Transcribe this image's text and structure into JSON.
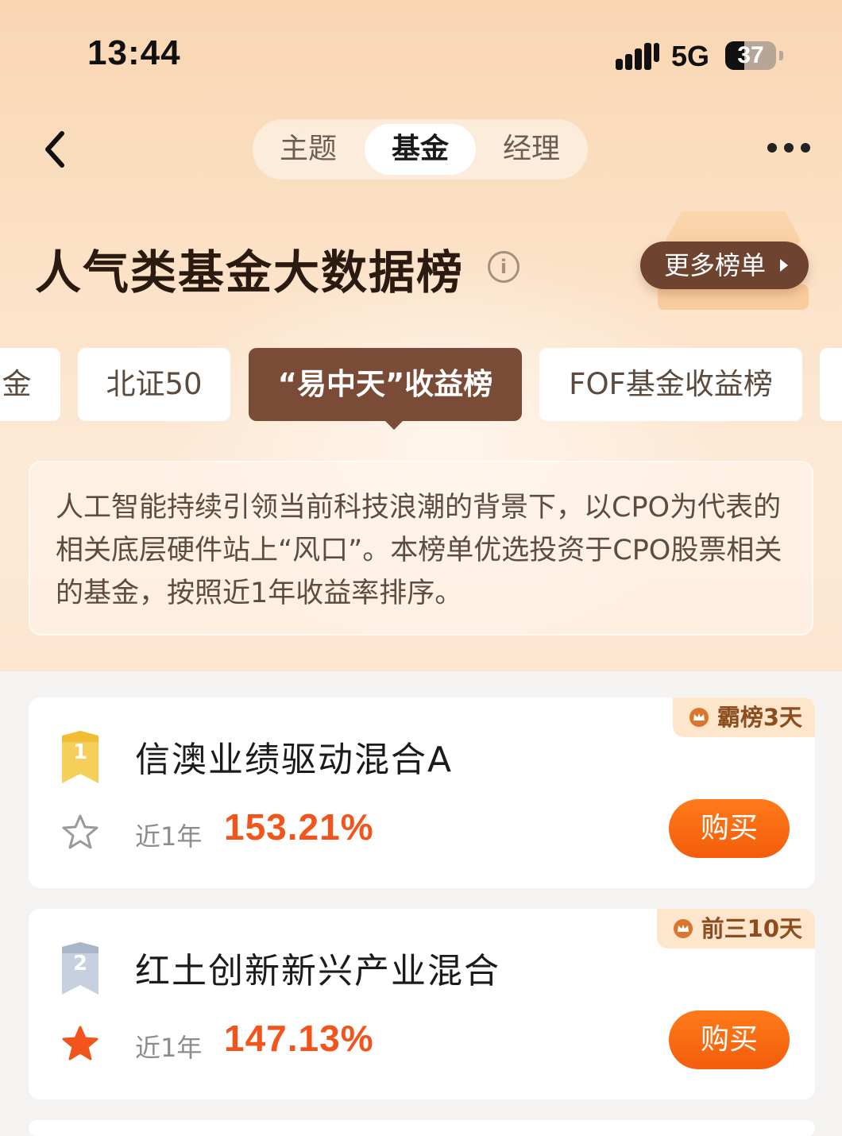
{
  "status_bar": {
    "time": "13:44",
    "network": "5G",
    "battery": "37"
  },
  "nav": {
    "tabs": [
      {
        "label": "主题",
        "active": false
      },
      {
        "label": "基金",
        "active": true
      },
      {
        "label": "经理",
        "active": false
      }
    ]
  },
  "header": {
    "title": "人气类基金大数据榜",
    "more_label": "更多榜单"
  },
  "categories": [
    {
      "label": "金",
      "active": false
    },
    {
      "label": "北证50",
      "active": false
    },
    {
      "label": "“易中天”收益榜",
      "active": true
    },
    {
      "label": "FOF基金收益榜",
      "active": false
    }
  ],
  "description": "人工智能持续引领当前科技浪潮的背景下，以CPO为代表的相关底层硬件站上“风口”。本榜单优选投资于CPO股票相关的基金，按照近1年收益率排序。",
  "funds": [
    {
      "rank": "1",
      "name": "信澳业绩驱动混合A",
      "badge": "霸榜3天",
      "period": "近1年",
      "return": "153.21%",
      "starred": false,
      "buy_label": "购买"
    },
    {
      "rank": "2",
      "name": "红土创新新兴产业混合",
      "badge": "前三10天",
      "period": "近1年",
      "return": "147.13%",
      "starred": true,
      "buy_label": "购买"
    }
  ],
  "colors": {
    "accent": "#f2541b",
    "chip_active": "#7a4b36",
    "buy": "#ff7a1a"
  },
  "icons": [
    "back-arrow-icon",
    "more-dots-icon",
    "info-icon",
    "play-triangle-icon",
    "trophy-icon",
    "medal-icon",
    "star-icon",
    "crown-icon"
  ]
}
